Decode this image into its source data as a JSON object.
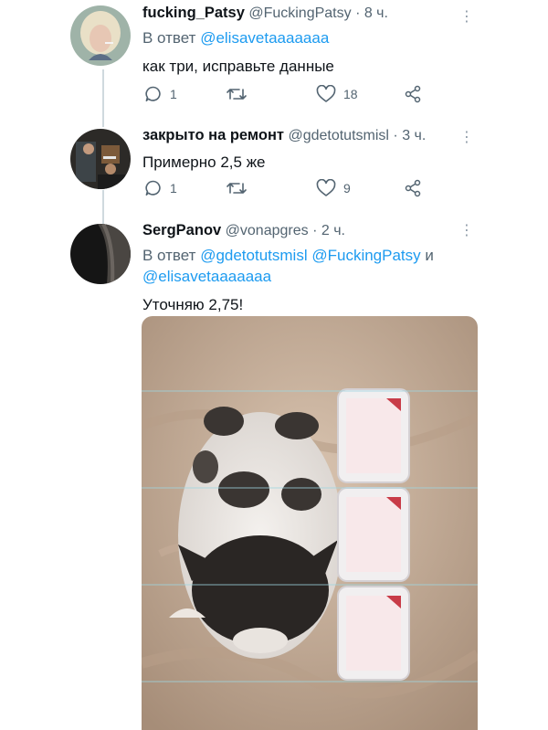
{
  "tweets": [
    {
      "name": "fucking_Patsy",
      "handle": "@FuckingPatsy",
      "time": "· 8 ч.",
      "reply_label": "В ответ",
      "reply_mentions": [
        "@elisavetaaaaaaa"
      ],
      "text": "как три, исправьте данные",
      "replies": "1",
      "retweets": "",
      "likes": "18"
    },
    {
      "name": "закрыто на ремонт",
      "handle": "@gdetotutsmisl",
      "time": "· 3 ч.",
      "text": "Примерно 2,5 же",
      "replies": "1",
      "retweets": "",
      "likes": "9"
    },
    {
      "name": "SergPanov",
      "handle": "@vonapgres",
      "time": "· 2 ч.",
      "reply_label": "В ответ",
      "reply_mentions": [
        "@gdetotutsmisl",
        "@FuckingPatsy",
        "@elisavetaaaaaaa"
      ],
      "reply_joiner": "и",
      "text": "Уточняю 2,75!"
    }
  ],
  "icons": {
    "reply": "reply-icon",
    "retweet": "retweet-icon",
    "like": "heart-icon",
    "share": "share-icon",
    "more": "more-icon"
  },
  "colors": {
    "mention": "#1d9bf0",
    "secondary_text": "#536471",
    "thread_line": "#cfd9de"
  }
}
